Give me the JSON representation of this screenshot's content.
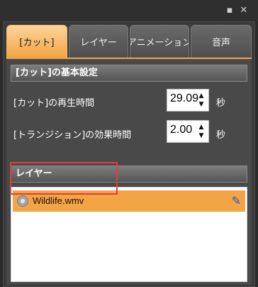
{
  "window": {
    "minimize_glyph": "▪",
    "close_glyph": "✕"
  },
  "tabs": [
    {
      "label": "[カット]",
      "active": true
    },
    {
      "label": "レイヤー",
      "active": false
    },
    {
      "label": "アニメーション",
      "active": false
    },
    {
      "label": "音声",
      "active": false
    }
  ],
  "cut_settings": {
    "header": "[カット]の基本設定",
    "playback": {
      "label": "[カット]の再生時間",
      "value": "29.09",
      "unit": "秒"
    },
    "transition": {
      "label": "[トランジション]の効果時間",
      "value": "2.00",
      "unit": "秒"
    }
  },
  "layers": {
    "header": "レイヤー",
    "items": [
      {
        "name": "Wildlife.wmv",
        "icon": "film-reel-icon",
        "selected": true
      }
    ]
  },
  "colors": {
    "accent": "#f3a445",
    "highlight_box": "#e43d3d"
  }
}
